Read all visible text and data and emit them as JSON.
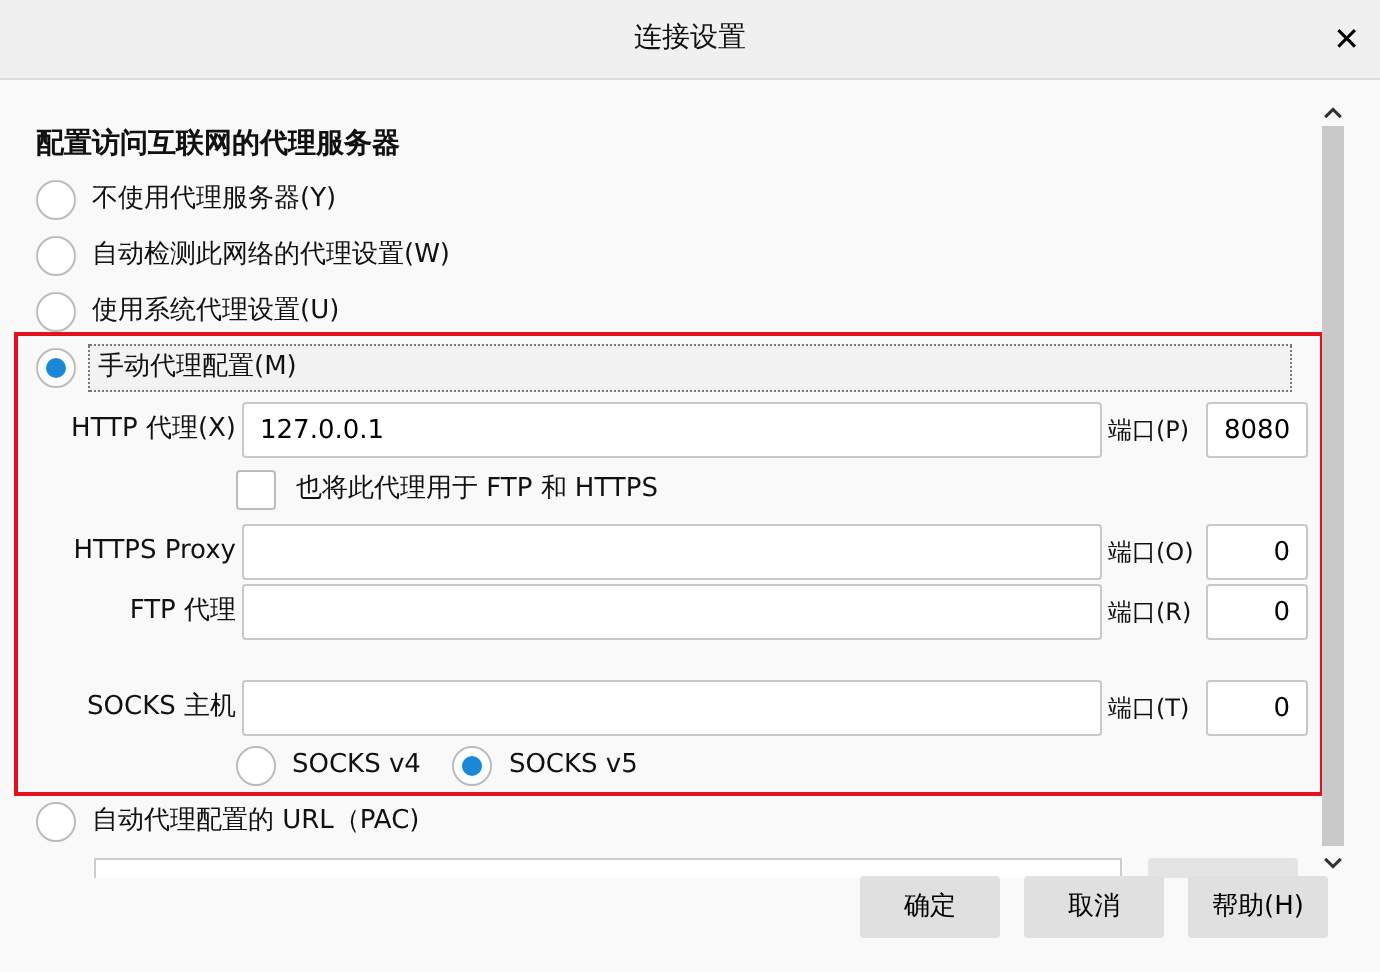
{
  "window": {
    "title": "连接设置",
    "close": "✕"
  },
  "heading": "配置访问互联网的代理服务器",
  "modes": [
    {
      "label": "不使用代理服务器(Y)",
      "selected": false
    },
    {
      "label": "自动检测此网络的代理设置(W)",
      "selected": false
    },
    {
      "label": "使用系统代理设置(U)",
      "selected": false
    },
    {
      "label": "手动代理配置(M)",
      "selected": true
    }
  ],
  "manual": {
    "http": {
      "label": "HTTP 代理(X)",
      "value": "127.0.0.1",
      "port_label": "端口(P)",
      "port": "8080"
    },
    "share": {
      "label": "也将此代理用于 FTP 和 HTTPS",
      "checked": false
    },
    "https": {
      "label": "HTTPS Proxy",
      "port_label": "端口(O)",
      "port": "0"
    },
    "ftp": {
      "label": "FTP 代理",
      "port_label": "端口(R)",
      "port": "0"
    },
    "socks": {
      "label": "SOCKS 主机",
      "port_label": "端口(T)",
      "port": "0"
    },
    "socks_versions": [
      {
        "label": "SOCKS v4",
        "selected": false
      },
      {
        "label": "SOCKS v5",
        "selected": true
      }
    ]
  },
  "pac": {
    "label": "自动代理配置的 URL（PAC)",
    "selected": false
  },
  "buttons": [
    "确定",
    "取消",
    "帮助(H)"
  ]
}
